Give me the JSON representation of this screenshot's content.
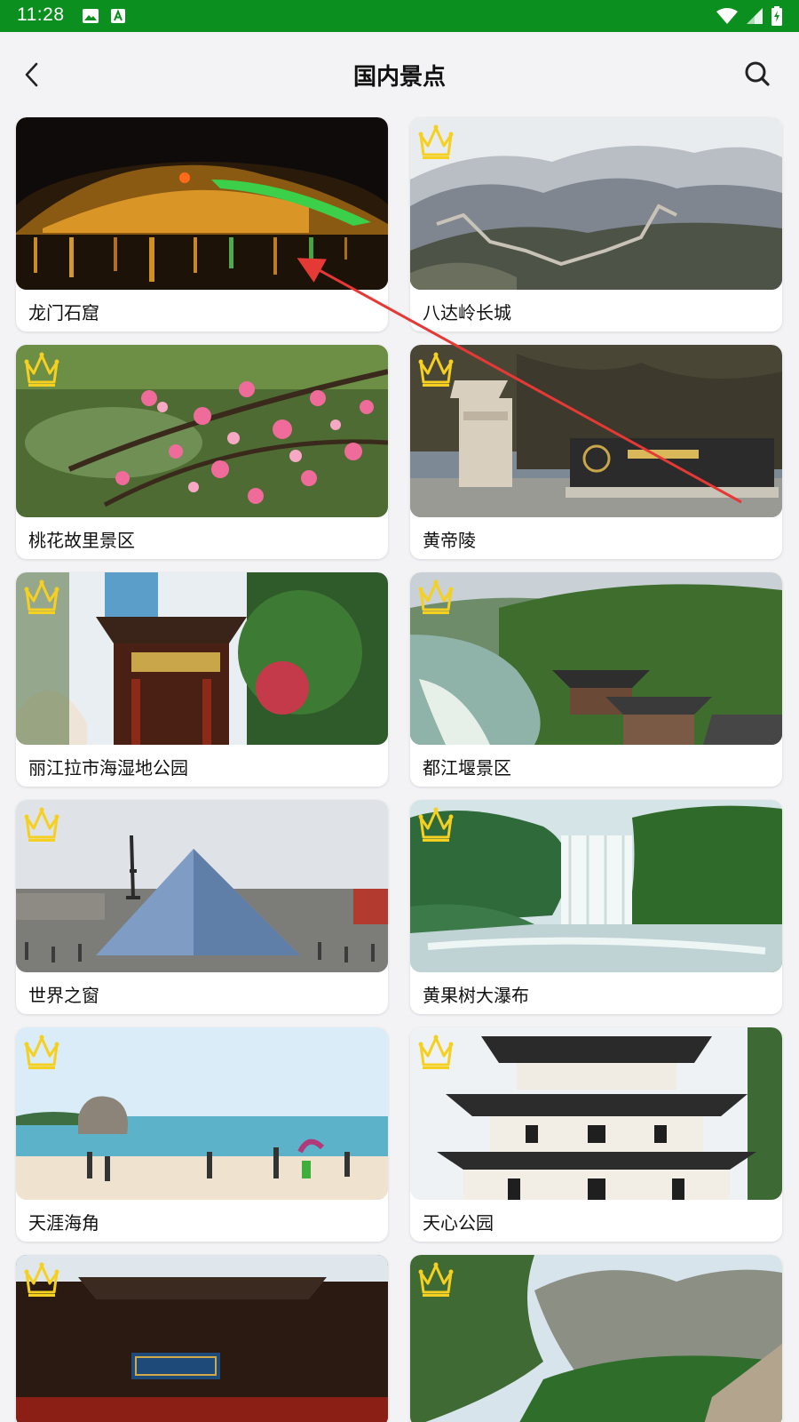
{
  "status_bar": {
    "time": "11:28",
    "icons": [
      "image-icon",
      "a-icon",
      "wifi-icon",
      "signal-icon",
      "battery-icon"
    ]
  },
  "header": {
    "title": "国内景点",
    "back_icon": "chevron-left-icon",
    "search_icon": "search-icon"
  },
  "colors": {
    "status_bar": "#0b8f1e",
    "background": "#f3f3f5",
    "crown": "#f5d020",
    "arrow": "#e53935"
  },
  "cards": [
    {
      "label": "龙门石窟",
      "premium": false,
      "scene": "night-river"
    },
    {
      "label": "八达岭长城",
      "premium": true,
      "scene": "great-wall"
    },
    {
      "label": "桃花故里景区",
      "premium": true,
      "scene": "peach-blossom"
    },
    {
      "label": "黄帝陵",
      "premium": true,
      "scene": "monument"
    },
    {
      "label": "丽江拉市海湿地公园",
      "premium": true,
      "scene": "pavilion-garden"
    },
    {
      "label": "都江堰景区",
      "premium": true,
      "scene": "river-temple"
    },
    {
      "label": "世界之窗",
      "premium": true,
      "scene": "pyramid"
    },
    {
      "label": "黄果树大瀑布",
      "premium": true,
      "scene": "waterfall"
    },
    {
      "label": "天涯海角",
      "premium": true,
      "scene": "beach"
    },
    {
      "label": "天心公园",
      "premium": true,
      "scene": "tower"
    },
    {
      "label": "",
      "premium": true,
      "scene": "temple-gate"
    },
    {
      "label": "",
      "premium": true,
      "scene": "mountains"
    }
  ]
}
